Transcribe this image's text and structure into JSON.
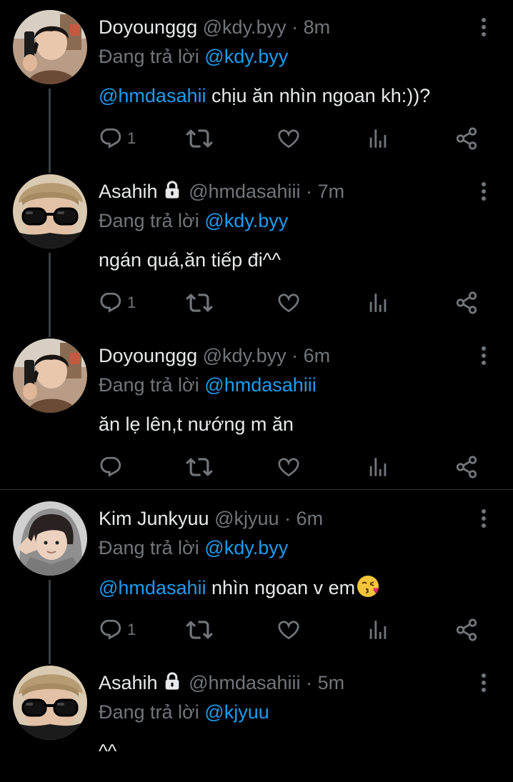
{
  "colors": {
    "background": "#000000",
    "text": "#e7e9ea",
    "muted": "#71767b",
    "link": "#1d9bf0",
    "thread_line": "#3a3d40"
  },
  "tweets": [
    {
      "name": "Doyounggg",
      "handle": "@kdy.byy",
      "time": "· 8m",
      "locked": false,
      "reply_label": "Đang trả lời",
      "reply_to": "@kdy.byy",
      "mention": "@hmdasahii",
      "text": "chịu ăn nhìn ngoan kh:))?",
      "reply_count": "1",
      "avatar": "avatar-doyoung"
    },
    {
      "name": "Asahih",
      "handle": "@hmdasahiii",
      "time": "· 7m",
      "locked": true,
      "reply_label": "Đang trả lời",
      "reply_to": "@kdy.byy",
      "mention": "",
      "text": "ngán quá,ăn tiếp đi^^",
      "reply_count": "1",
      "avatar": "avatar-asahi"
    },
    {
      "name": "Doyounggg",
      "handle": "@kdy.byy",
      "time": "· 6m",
      "locked": false,
      "reply_label": "Đang trả lời",
      "reply_to": "@hmdasahiii",
      "mention": "",
      "text": "ăn lẹ lên,t nướng m ăn",
      "reply_count": "",
      "avatar": "avatar-doyoung"
    },
    {
      "name": "Kim Junkyuu",
      "handle": "@kjyuu",
      "time": "· 6m",
      "locked": false,
      "reply_label": "Đang trả lời",
      "reply_to": "@kdy.byy",
      "mention": "@hmdasahii",
      "text": "nhìn ngoan v em",
      "emoji": "kissing-face-emoji",
      "reply_count": "1",
      "avatar": "avatar-junkyu"
    },
    {
      "name": "Asahih",
      "handle": "@hmdasahiii",
      "time": "· 5m",
      "locked": true,
      "reply_label": "Đang trả lời",
      "reply_to": "@kjyuu",
      "mention": "",
      "text": "^^",
      "avatar": "avatar-asahi"
    }
  ],
  "icons": [
    "reply-icon",
    "retweet-icon",
    "like-icon",
    "views-icon",
    "share-icon",
    "more-icon",
    "lock-icon"
  ]
}
